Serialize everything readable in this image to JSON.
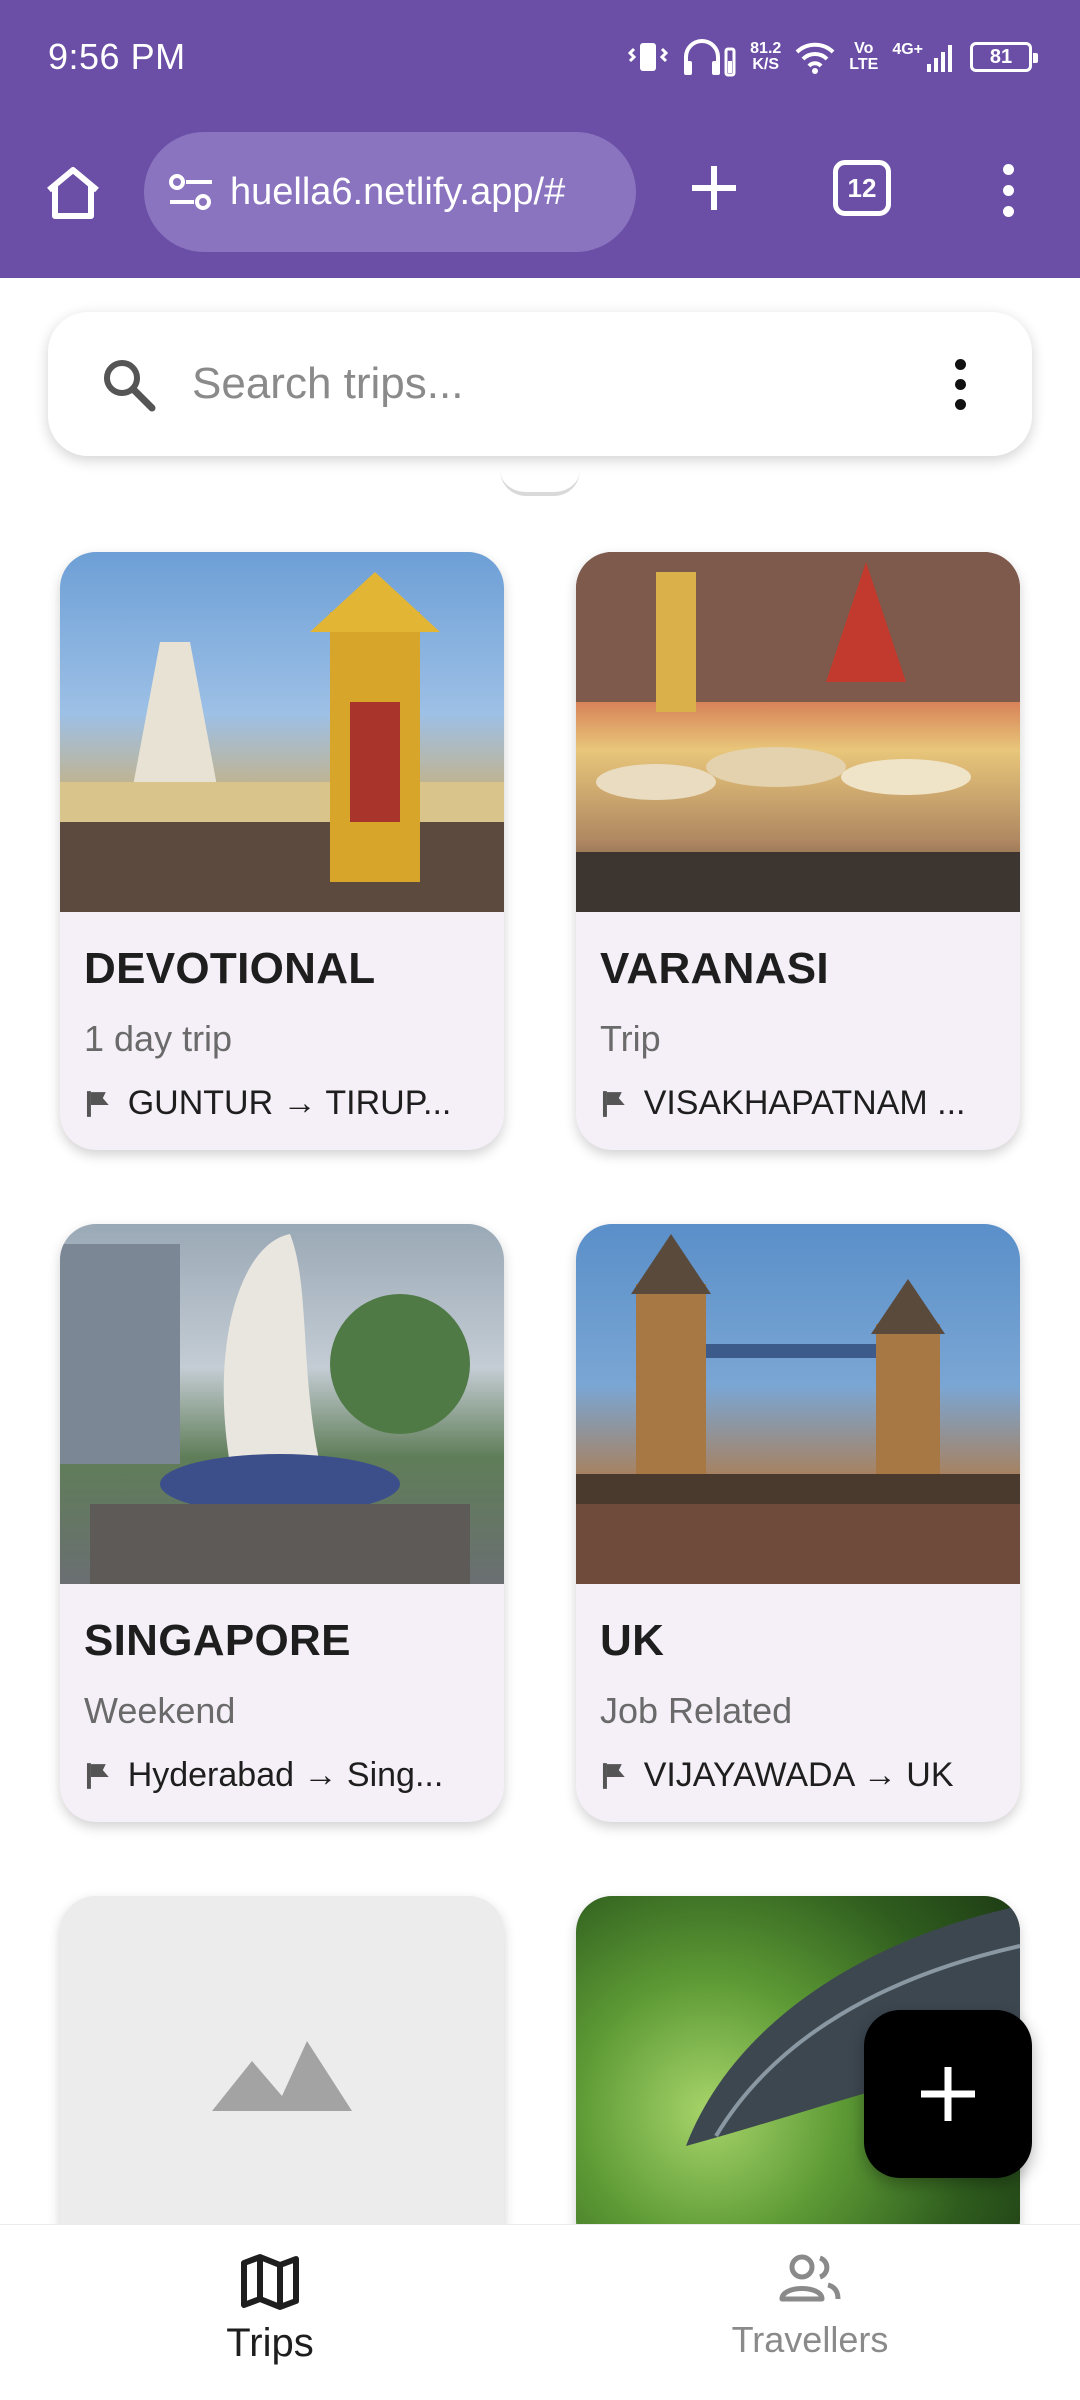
{
  "status_bar": {
    "time": "9:56 PM",
    "speed_value": "81.2",
    "speed_unit": "K/S",
    "volte_top": "Vo",
    "volte_bottom": "LTE",
    "network": "4G+",
    "battery": "81"
  },
  "browser": {
    "url": "huella6.netlify.app/#",
    "tab_count": "12"
  },
  "search": {
    "placeholder": "Search trips..."
  },
  "trips": [
    {
      "title": "DEVOTIONAL",
      "type": "1 day trip",
      "route": "GUNTUR → TIRUP..."
    },
    {
      "title": "VARANASI",
      "type": "Trip",
      "route": "VISAKHAPATNAM ..."
    },
    {
      "title": "SINGAPORE",
      "type": "Weekend",
      "route": "Hyderabad → Sing..."
    },
    {
      "title": "UK",
      "type": "Job Related",
      "route": "VIJAYAWADA → UK"
    }
  ],
  "bottom_nav": {
    "trips_label": "Trips",
    "travellers_label": "Travellers"
  },
  "colors": {
    "chrome": "#6b4fa6",
    "url_bar": "#8a74c0",
    "card_bg": "#f5f0f8",
    "fab": "#000000"
  }
}
